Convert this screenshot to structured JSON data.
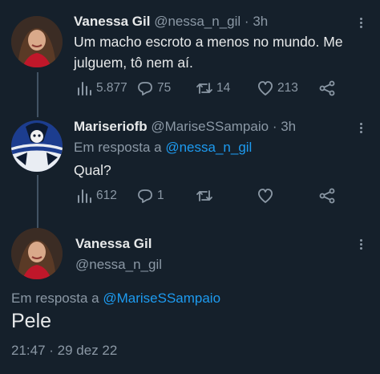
{
  "tweet1": {
    "name": "Vanessa Gil",
    "handle": "@nessa_n_gil",
    "separator": "·",
    "time": "3h",
    "text_line1": "Um macho escroto a menos no mundo. Me",
    "text_line2": "julguem, tô nem aí.",
    "views": "5.877",
    "replies": "75",
    "retweets": "14",
    "likes": "213"
  },
  "tweet2": {
    "name": "Mariseriofb",
    "handle": "@MariseSSampaio",
    "separator": "·",
    "time": "3h",
    "reply_prefix": "Em resposta a",
    "reply_target": "@nessa_n_gil",
    "text": "Qual?",
    "views": "612",
    "replies": "1",
    "retweets": "",
    "likes": ""
  },
  "tweet3": {
    "name": "Vanessa Gil",
    "handle": "@nessa_n_gil",
    "reply_prefix": "Em resposta a",
    "reply_target": "@MariseSSampaio",
    "text": "Pele",
    "timestamp": "21:47 · 29 dez 22"
  },
  "colors": {
    "background": "#15202b",
    "text": "#e7e9ea",
    "muted": "#8b98a5",
    "link": "#1d9bf0",
    "thread_line": "#425364"
  },
  "icons": [
    "views-icon",
    "reply-icon",
    "retweet-icon",
    "like-icon",
    "share-icon",
    "more-icon"
  ]
}
